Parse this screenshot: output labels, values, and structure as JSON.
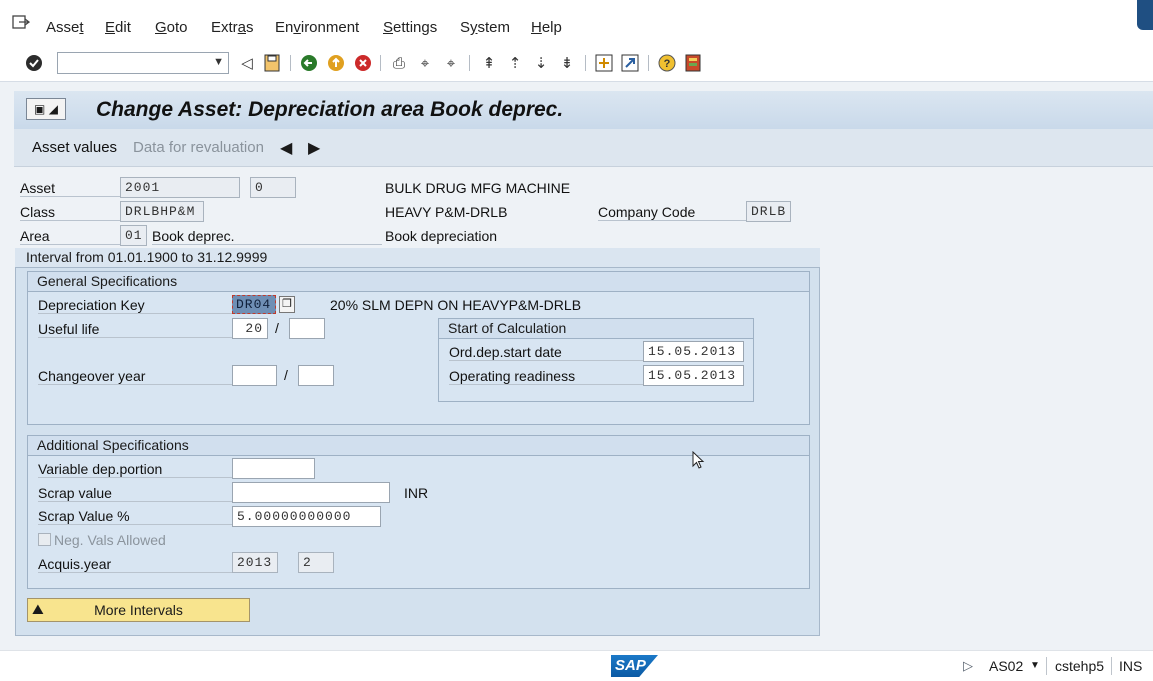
{
  "menu": {
    "items": [
      {
        "pre": "Asse",
        "u": "t",
        "post": ""
      },
      {
        "pre": "",
        "u": "E",
        "post": "dit"
      },
      {
        "pre": "",
        "u": "G",
        "post": "oto"
      },
      {
        "pre": "Extr",
        "u": "a",
        "post": "s"
      },
      {
        "pre": "En",
        "u": "v",
        "post": "ironment"
      },
      {
        "pre": "",
        "u": "S",
        "post": "ettings"
      },
      {
        "pre": "S",
        "u": "y",
        "post": "stem"
      },
      {
        "pre": "",
        "u": "H",
        "post": "elp"
      }
    ]
  },
  "toolbar": {
    "command_field_value": "",
    "icons": [
      "enter-check-icon",
      "back-triangle-icon",
      "save-icon",
      "back-icon",
      "exit-icon",
      "cancel-icon",
      "print-icon",
      "find-icon",
      "find-next-icon",
      "first-page-icon",
      "previous-page-icon",
      "next-page-icon",
      "last-page-icon",
      "create-session-icon",
      "shortcut-icon",
      "help-icon",
      "customize-layout-icon"
    ]
  },
  "header": {
    "title": "Change Asset: Depreciation area Book deprec."
  },
  "app_toolbar": {
    "asset_values": "Asset values",
    "data_for_revaluation": "Data for revaluation"
  },
  "asset": {
    "asset_label": "Asset",
    "asset_number": "2001",
    "sub_number": "0",
    "asset_description": "BULK DRUG MFG MACHINE",
    "class_label": "Class",
    "class_value": "DRLBHP&M",
    "class_description": "HEAVY P&M-DRLB",
    "company_code_label": "Company Code",
    "company_code_value": "DRLB",
    "area_label": "Area",
    "area_number": "01",
    "area_name": "Book deprec.",
    "area_description": "Book depreciation"
  },
  "interval": {
    "label": "Interval from 01.01.1900 to 31.12.9999"
  },
  "general": {
    "heading": "General Specifications",
    "dep_key_label": "Depreciation Key",
    "dep_key_value": "DR04",
    "dep_key_description": "20% SLM DEPN ON HEAVYP&M-DRLB",
    "useful_life_label": "Useful life",
    "useful_life_years": "20",
    "useful_life_periods": "",
    "changeover_label": "Changeover year",
    "changeover_year": "",
    "changeover_period": "",
    "slash": "/"
  },
  "start_calc": {
    "heading": "Start of Calculation",
    "ord_dep_label": "Ord.dep.start date",
    "ord_dep_value": "15.05.2013",
    "op_ready_label": "Operating readiness",
    "op_ready_value": "15.05.2013"
  },
  "additional": {
    "heading": "Additional Specifications",
    "var_dep_label": "Variable dep.portion",
    "var_dep_value": "",
    "scrap_value_label": "Scrap value",
    "scrap_value_value": "",
    "currency": "INR",
    "scrap_pct_label": "Scrap Value %",
    "scrap_pct_value": "5.00000000000",
    "neg_vals_label": "Neg. Vals Allowed",
    "neg_vals_checked": false,
    "acquis_label": "Acquis.year",
    "acquis_year": "2013",
    "acquis_period": "2"
  },
  "more_intervals": "More Intervals",
  "status": {
    "logo": "SAP",
    "transaction": "AS02",
    "server": "cstehp5",
    "mode": "INS"
  }
}
